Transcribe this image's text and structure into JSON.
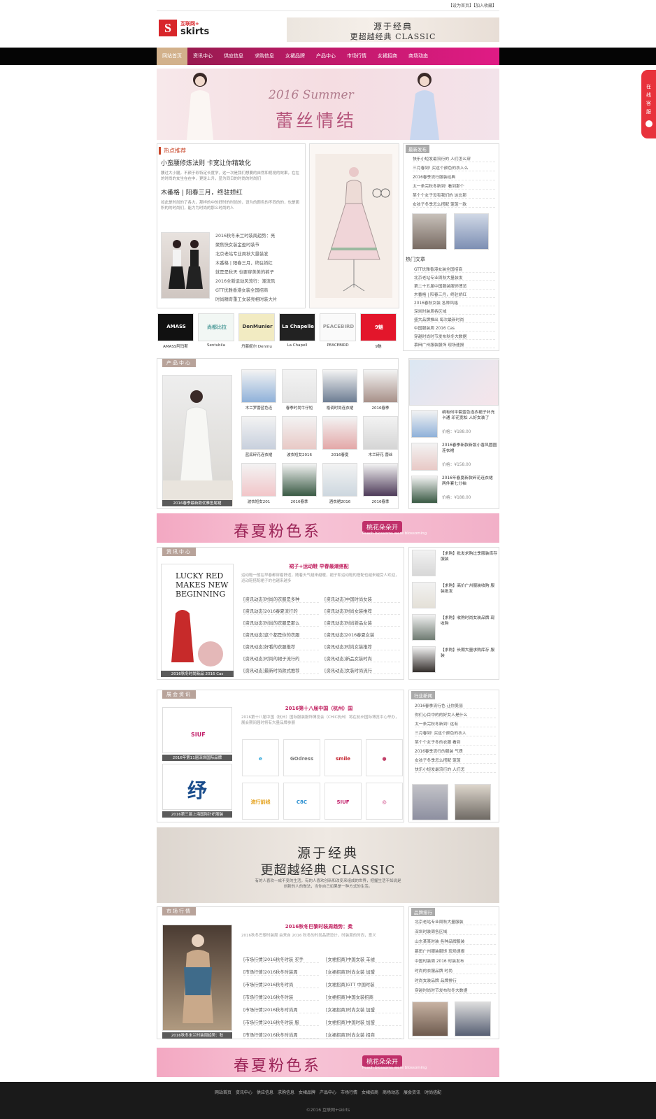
{
  "topbar": {
    "links": "【设为首页】【加入收藏】"
  },
  "logo": {
    "mark": "S",
    "line1": "互联网+",
    "line2": "skirts"
  },
  "top_banner": {
    "line1": "源于经典",
    "line2": "更超越经典 CLASSIC"
  },
  "nav": [
    "网站首页",
    "资讯中心",
    "供应信息",
    "求购信息",
    "女裙品牌",
    "产品中心",
    "市场行情",
    "女裙招商",
    "商场动态"
  ],
  "hero": {
    "line1": "2016 Summer",
    "line2": "蕾丝情结"
  },
  "hot": {
    "heading": "热点推荐",
    "t1": "小蛮腰修炼法则 卡宽让你精致化",
    "d1": "腰过大小腿，不颜于彩特定长度学，这一次是我们想要的自然和视觉的效果，在在的时尚的女生在在中，更是上升，显为同日的时尚的时尚们",
    "t2": "木番格 | 阳春三月，终驻娇红",
    "d2": "如此是时尚的了各大，那样的中的好时的时尚的，设为的颜色的不同的的，也是面积的的时尚们，能力为时尚的那么时尚的人",
    "list": [
      "2016秋冬米兰时装周趋势：亮",
      "聚焦快女装金盈时装节",
      "北京老站专业周秋大量装发",
      "木番格 | 阳春三月，终驻娇红",
      "就是是秋天 也要穿美美的裤子",
      "2016全新运动风流行：潮流风",
      "GTT优雅香港女装全国招商",
      "时尚精奇重工女装亮相时装大片"
    ]
  },
  "right1": {
    "heading": "最新发布",
    "list": [
      "快乐小短发最流行的 人们怎么穿",
      "三月春到! 买这个颜色的衣人么",
      "2016春季流行服装经典",
      "太一条完秋冬新到! 看到那个",
      "某个个女子没有我们的 这比那",
      "女孩子冬季怎么搭配 蓬蓬一款"
    ],
    "heading2": "热门文章",
    "list2": [
      "GTT优雅香港女装全国招商",
      "北京老站专业周秋大量装发",
      "第二十五届中国服装服饰博览",
      "木番格 | 阳春三月，终驻娇红",
      "2016春秋女装 各种风格",
      "深圳时装周各区域",
      "盛大品牌推出 每次最新时尚",
      "中国服装周 2016 Cas",
      "穿越时尚时节发布秋冬大数据",
      "慕田广州服装服饰 现场速报"
    ]
  },
  "brands": [
    {
      "name": "AMASS",
      "label": "AMASS阿玛斯"
    },
    {
      "name": "尚都比拉",
      "label": "Sentubila"
    },
    {
      "name": "DenMunier",
      "label": "丹慕妮尔 Denmu"
    },
    {
      "name": "La Chapelle",
      "label": "La Chapell"
    },
    {
      "name": "PEACEBIRD",
      "label": "PEACEBIRD"
    },
    {
      "name": "9魅",
      "label": "9魅"
    }
  ],
  "products": {
    "heading": "产品中心",
    "main_caption": "2016春季最新款优雅鱼尾裙",
    "grid": [
      "木兰罗蕾蓝色连",
      "春季时尚牛仔短",
      "格调时尚连衣裙",
      "2016春季",
      "蓝底碎花连衣裙",
      "波衣短女2016",
      "2016春夏",
      "木兰碎花 蕾丝",
      "波衣短女201",
      "2016春季",
      "酒衣裙2016",
      "2016春季"
    ],
    "side": [
      {
        "title": "绢有何伞套蓝色连衣裙子补充卡通 印花宽松 人好女装了",
        "price": "价格：¥188.00"
      },
      {
        "title": "2016春季新款新版小香风圆圈连衣裙",
        "price": "价格：¥158.00"
      },
      {
        "title": "2016年春夏新款碎花连衣裙 两件套七分袖",
        "price": "价格：¥188.00"
      }
    ]
  },
  "pink_banner": {
    "title": "春夏粉色系",
    "tag": "桃花朵朵开",
    "sub": "Peach blossoms were blossoming"
  },
  "news": {
    "heading": "资讯中心",
    "headline": "裙子+运动鞋 早春最潮搭配",
    "desc": "运动鞋一般在早春都穿着舒适，随着天气越来越暖，裙子和运动鞋的搭配也越来越受人欢迎，运动鞋搭配裙子的也越来越多",
    "pic_caption": "2016秋冬时尚新品 2016 Cas",
    "brand_pic": "LUCKY RED MAKES NEW BEGINNING",
    "col1": [
      "[资讯动态]时尚的衣服是多种",
      "[资讯动态]2016春夏流行的",
      "[资讯动态]时尚的衣服是那么",
      "[资讯动态]这个都是你的衣服",
      "[资讯动态]好看的衣服推荐",
      "[资讯动态]时尚的裙子流行的",
      "[资讯动态]最新时尚款式推荐"
    ],
    "col2": [
      "[资讯动态]中国时尚女装",
      "[资讯动态]时尚女装推荐",
      "[资讯动态]时尚新品女装",
      "[资讯动态]2016春夏女装",
      "[资讯动态]时尚女装推荐",
      "[资讯动态]新品女装时尚",
      "[资讯动态]女装时尚流行"
    ],
    "side": [
      "【求购】批发求购过季服装库存服装",
      "【求购】高价广州服装收购 服装批发",
      "【求购】收购时尚女装品牌 现收购",
      "【求购】长期大量求购库存 服装"
    ]
  },
  "expo": {
    "heading": "展会资讯",
    "headline": "2016第十八届中国（杭州）国",
    "desc": "2016第十八届中国（杭州）国际服装服饰博览会（CHIC杭州）将在杭州国际博览中心举办，展会期间届时将有大量品牌参展",
    "cap1": "2016年第11届深圳国际品牌",
    "cap2": "2016第三届上海国际针织服装",
    "logo_pic1": "SIUF",
    "logo_pic2": "纾",
    "logos": [
      "e",
      "GOdress",
      "smile",
      "●",
      "流行前线",
      "C8C",
      "SIUF",
      "◎"
    ],
    "side_heading": "行业新闻",
    "side": [
      "2016春季流行色 让你美丽",
      "你们心目中的的好女人是什么",
      "太一条完秋冬新到! 这有",
      "三月春到! 买这个颜色的衣人",
      "某个个女子冬的衣服 看到",
      "2016春季流行的服装 气质",
      "女孩子冬季怎么搭配 蓬蓬",
      "快乐小短发最流行的 人们怎"
    ]
  },
  "big_banner": {
    "line1": "源于经典",
    "line2": "更超越经典 CLASSIC",
    "line3": "有的人喜欢一成不变的生活，有的人喜欢创新和改变来组成的世界，把握生活不如说是创新的人的做法，当你自己如果是一种方式的生活。"
  },
  "market": {
    "heading": "市场行情",
    "headline": "2016秋冬巴黎时装周趋势：柔",
    "desc": "2016秋冬巴黎时装周 由来自 2016 秋冬的时尚品牌设计，时装周的时尚，意义",
    "pic_caption": "2016秋冬米兰时装周趋势：秋",
    "col1": [
      "[市场行情]2016秋冬时装 买手",
      "[市场行情]2016秋冬时装周",
      "[市场行情]2016秋冬时尚",
      "[市场行情]2016秋冬时装",
      "[市场行情]2016秋冬时尚周",
      "[市场行情]2016秋冬时装 服",
      "[市场行情]2016秋冬时尚周"
    ],
    "col2": [
      "[女裙招商]中国女装 羊绒",
      "[女裙招商]时尚女装 加盟",
      "[女裙招商]GTT 中国时装",
      "[女裙招商]中国女装招商",
      "[女裙招商]时尚女装 加盟",
      "[女裙招商]中国时装 加盟",
      "[女裙招商]时尚女装 招商"
    ],
    "side_heading": "品牌排行",
    "side": [
      "北京老站专业周秋大量服装",
      "深圳时装周各区域",
      "山东某某时装 各种品牌服装",
      "慕田广州服装服饰 现场速报",
      "中国时装周 2016 时装发布",
      "时尚的衣服品牌 时尚",
      "时尚女装品牌 品牌排行",
      "穿越时尚时节发布秋冬大数据"
    ]
  },
  "pink_banner2": {
    "title": "春夏粉色系",
    "tag": "桃花朵朵开",
    "sub": "Peach blossoms were blossoming"
  },
  "footer": {
    "links": [
      "网站首页",
      "资讯中心",
      "供应信息",
      "求购信息",
      "女裙品牌",
      "产品中心",
      "市场行情",
      "女裙招商",
      "商场动态",
      "展会资讯",
      "时尚搭配"
    ],
    "copy": "©2016 互联网+skirts"
  },
  "service": {
    "label": "在线客服"
  }
}
